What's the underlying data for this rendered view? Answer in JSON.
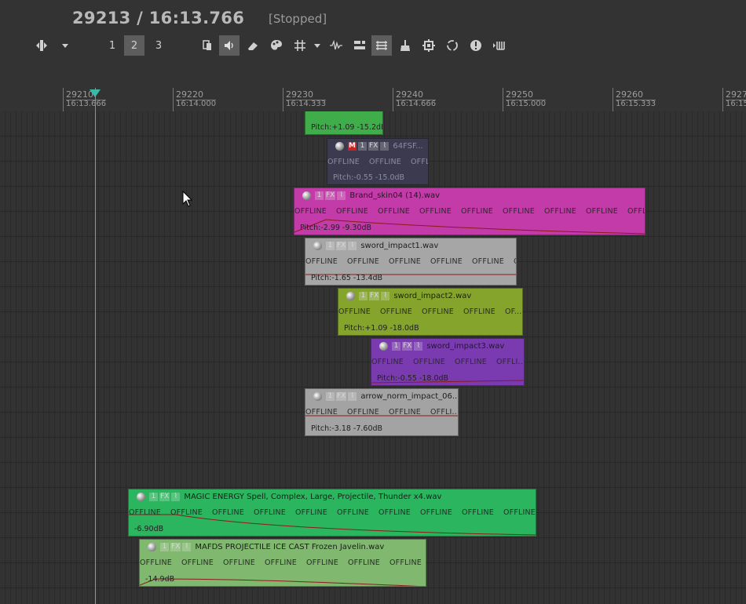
{
  "transport": {
    "position": "29213 / 16:13.766",
    "status": "[Stopped]"
  },
  "toolbar": {
    "lanes": [
      "1",
      "2",
      "3"
    ],
    "active_lane": "2",
    "tools": [
      "move-tool-icon",
      "dropdown-arrow-icon",
      "snap-icon",
      "speaker-icon",
      "eraser-icon",
      "palette-icon",
      "grid-icon",
      "grid-dropdown-icon",
      "waveform-icon",
      "align-icon",
      "bracket-icon",
      "broom-icon",
      "gear-icon",
      "loop-icon",
      "info-icon",
      "midi-icon"
    ]
  },
  "ruler": [
    {
      "frame": "29210",
      "time": "16:13.666"
    },
    {
      "frame": "29220",
      "time": "16:14.000"
    },
    {
      "frame": "29230",
      "time": "16:14.333"
    },
    {
      "frame": "29240",
      "time": "16:14.666"
    },
    {
      "frame": "29250",
      "time": "16:15.000"
    },
    {
      "frame": "29260",
      "time": "16:15.333"
    },
    {
      "frame": "2927",
      "time": "16:15"
    }
  ],
  "clips": [
    {
      "name": "",
      "info": "Pitch:+1.09 -15.2dB",
      "color": "#3fae4a",
      "offline_count": 0,
      "buttons": []
    },
    {
      "name": "64FSF...",
      "info": "Pitch:-0.55 -15.0dB",
      "color": "#3c3a4e",
      "offline_count": 3,
      "offline_tail": "OF",
      "buttons": [
        "M",
        "1",
        "FX",
        "env"
      ]
    },
    {
      "name": "Brand_skin04 (14).wav",
      "info": "Pitch:-2.99 -9.30dB",
      "color": "#c23ba8",
      "offline_count": 9,
      "offline_tail": "OF...",
      "buttons": [
        "1",
        "FX",
        "env"
      ]
    },
    {
      "name": "sword_impact1.wav",
      "info": "Pitch:-1.65 -13.4dB",
      "color": "#a6a6a6",
      "offline_count": 5,
      "offline_tail": "O",
      "buttons": [
        "1",
        "FX",
        "env"
      ]
    },
    {
      "name": "sword_impact2.wav",
      "info": "Pitch:+1.09 -18.0dB",
      "color": "#84a42c",
      "offline_count": 4,
      "offline_tail": "OF...",
      "buttons": [
        "1",
        "FX",
        "env"
      ]
    },
    {
      "name": "sword_impact3.wav",
      "info": "Pitch:-0.55 -18.0dB",
      "color": "#7b3bb0",
      "offline_count": 3,
      "offline_tail": "OFFLI...",
      "buttons": [
        "1",
        "FX",
        "env"
      ]
    },
    {
      "name": "arrow_norm_impact_06...",
      "info": "Pitch:-3.18 -7.60dB",
      "color": "#a3a3a3",
      "offline_count": 3,
      "offline_tail": "OFFLI...",
      "buttons": [
        "1",
        "FX",
        "env"
      ]
    },
    {
      "name": "MAGIC ENERGY Spell, Complex, Large, Projectile, Thunder x4.wav",
      "info": "-6.90dB",
      "color": "#2ab55e",
      "offline_count": 10,
      "offline_tail": "",
      "buttons": [
        "1",
        "FX",
        "env"
      ]
    },
    {
      "name": "MAFDS PROJECTILE ICE CAST Frozen Javelin.wav",
      "info": "-14.9dB",
      "color": "#7fb86e",
      "offline_count": 7,
      "offline_tail": "",
      "buttons": [
        "1",
        "FX",
        "env"
      ]
    }
  ],
  "offline_label": "OFFLINE",
  "colors": {
    "background": "#333333",
    "playhead": "#3cb8a6",
    "envelope": "#8b1a1a"
  }
}
